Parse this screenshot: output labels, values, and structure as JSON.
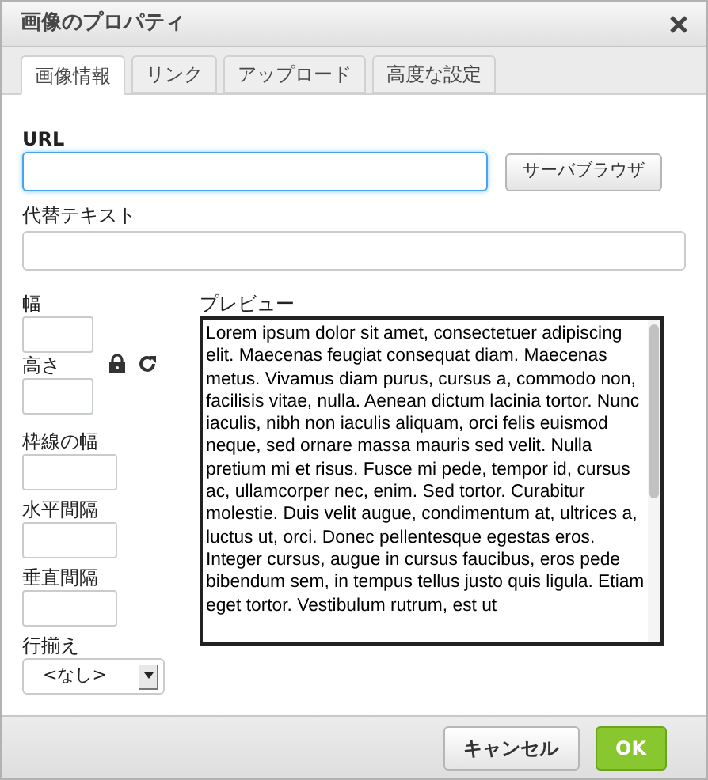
{
  "window": {
    "title": "画像のプロパティ"
  },
  "tabs": [
    {
      "label": "画像情報",
      "selected": true
    },
    {
      "label": "リンク",
      "selected": false
    },
    {
      "label": "アップロード",
      "selected": false
    },
    {
      "label": "高度な設定",
      "selected": false
    }
  ],
  "url": {
    "label": "URL",
    "focused": true,
    "browse_button": "サーバブラウザ"
  },
  "alt_text": {
    "label": "代替テキスト"
  },
  "width": {
    "label": "幅"
  },
  "height": {
    "label": "高さ"
  },
  "border": {
    "label": "枠線の幅"
  },
  "hspace": {
    "label": "水平間隔"
  },
  "vspace": {
    "label": "垂直間隔"
  },
  "align": {
    "label": "行揃え",
    "value": "<なし>"
  },
  "preview": {
    "label": "プレビュー",
    "text": "Lorem ipsum dolor sit amet, consectetuer adipiscing elit. Maecenas feugiat consequat diam. Maecenas metus. Vivamus diam purus, cursus a, commodo non, facilisis vitae, nulla. Aenean dictum lacinia tortor. Nunc iaculis, nibh non iaculis aliquam, orci felis euismod neque, sed ornare massa mauris sed velit. Nulla pretium mi et risus. Fusce mi pede, tempor id, cursus ac, ullamcorper nec, enim. Sed tortor. Curabitur molestie. Duis velit augue, condimentum at, ultrices a, luctus ut, orci. Donec pellentesque egestas eros. Integer cursus, augue in cursus faucibus, eros pede bibendum sem, in tempus tellus justo quis ligula. Etiam eget tortor. Vestibulum rutrum, est ut"
  },
  "buttons": [
    {
      "label": "キャンセル",
      "kind": "secondary"
    },
    {
      "label": "OK",
      "kind": "primary"
    }
  ]
}
